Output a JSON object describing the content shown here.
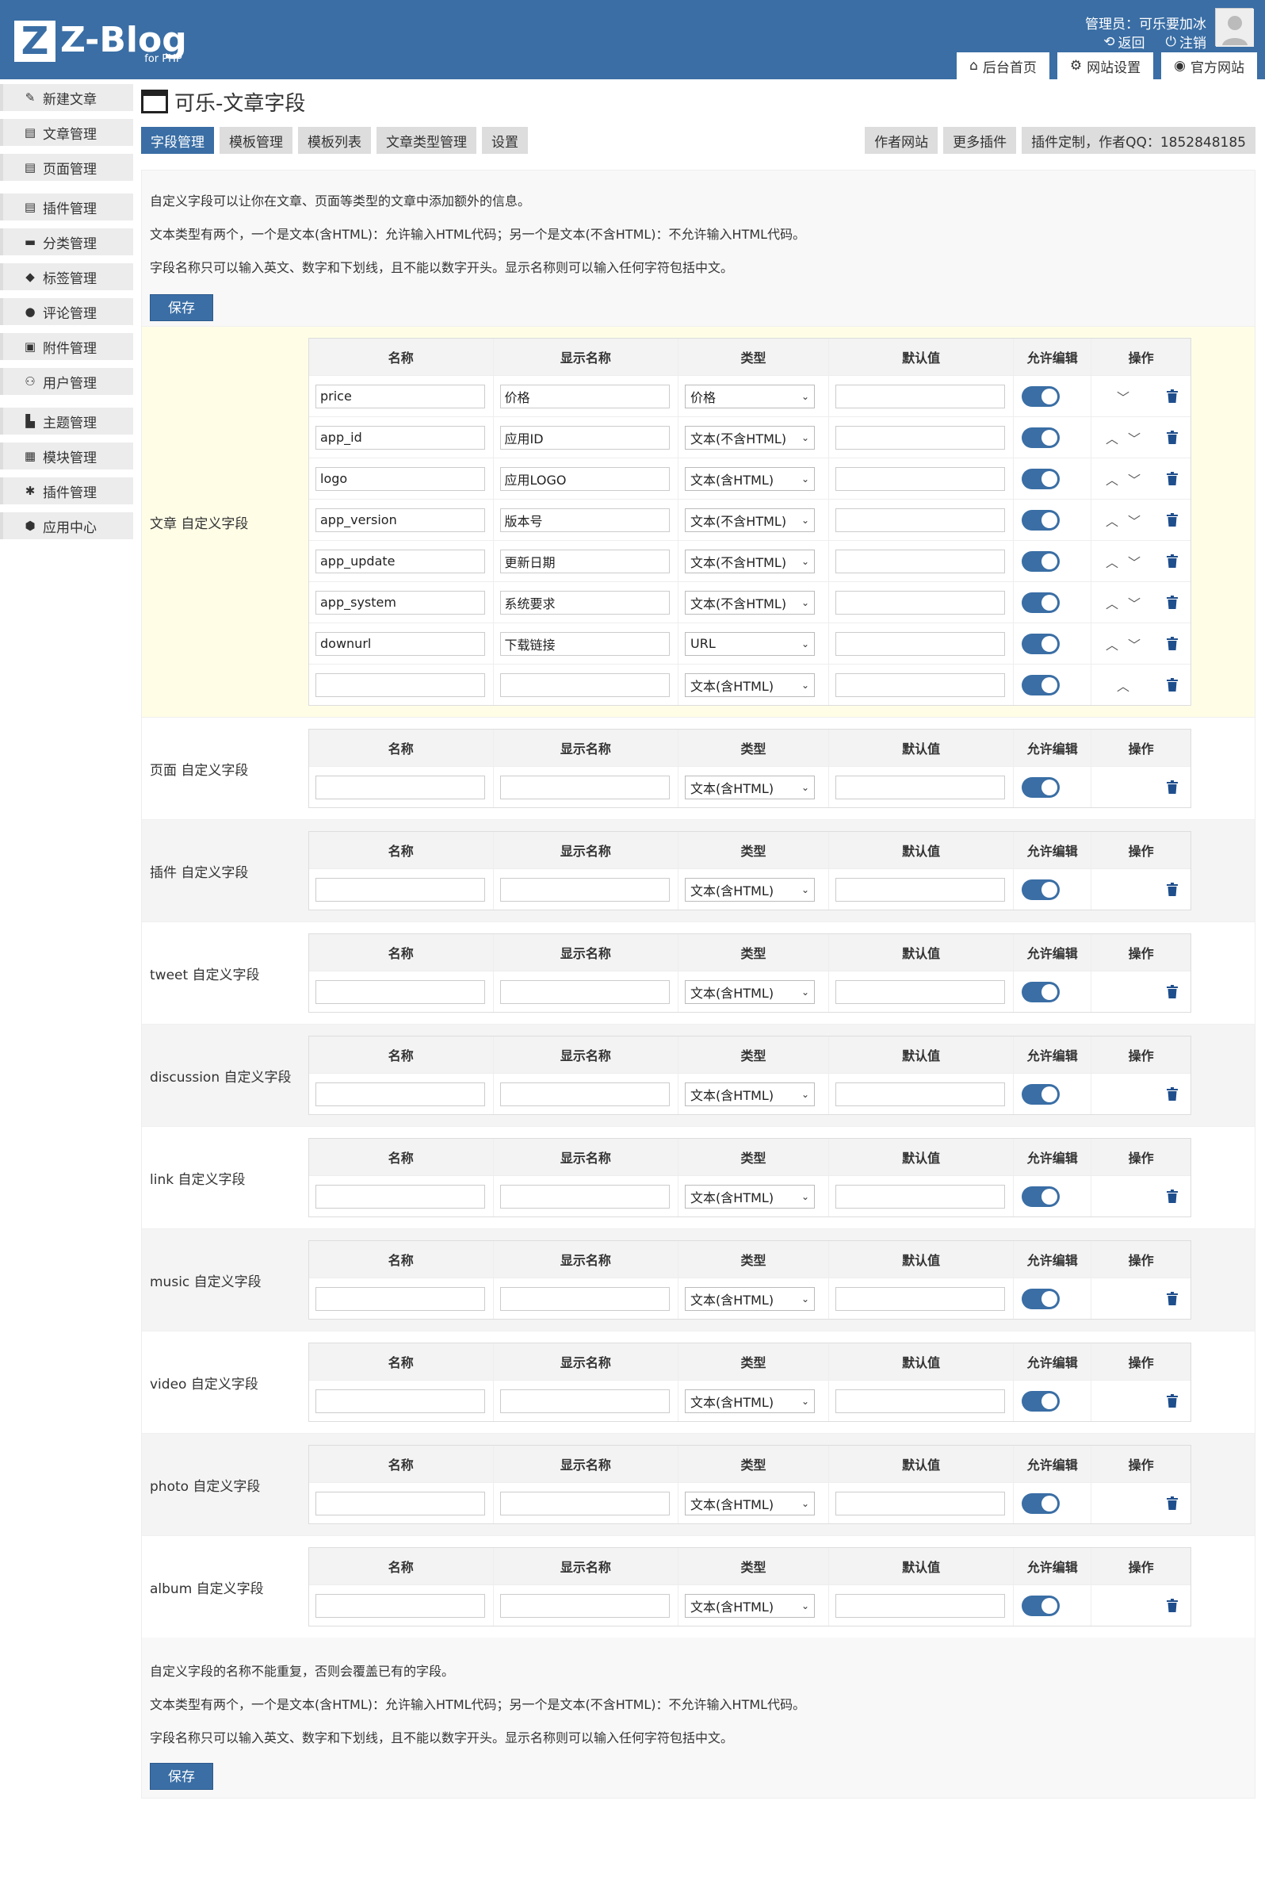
{
  "header": {
    "logo": "Z-Blog",
    "logo_sub": "for PHP",
    "admin": "管理员：可乐要加冰",
    "back": "返回",
    "logout": "注销",
    "tabs": [
      {
        "label": "后台首页",
        "icon": "home-icon"
      },
      {
        "label": "网站设置",
        "icon": "gear-icon"
      },
      {
        "label": "官方网站",
        "icon": "zblog-icon"
      }
    ]
  },
  "sidebar": {
    "items": [
      {
        "label": "新建文章",
        "icon": "pencil-icon"
      },
      {
        "label": "文章管理",
        "icon": "article-icon"
      },
      {
        "label": "页面管理",
        "icon": "page-icon"
      },
      {
        "label": "插件管理",
        "icon": "plugin-list-icon"
      },
      {
        "label": "分类管理",
        "icon": "folder-icon"
      },
      {
        "label": "标签管理",
        "icon": "tag-icon"
      },
      {
        "label": "评论管理",
        "icon": "comment-icon"
      },
      {
        "label": "附件管理",
        "icon": "attachment-icon"
      },
      {
        "label": "用户管理",
        "icon": "users-icon"
      },
      {
        "label": "主题管理",
        "icon": "theme-icon"
      },
      {
        "label": "模块管理",
        "icon": "module-icon"
      },
      {
        "label": "插件管理",
        "icon": "puzzle-icon"
      },
      {
        "label": "应用中心",
        "icon": "box-icon"
      }
    ]
  },
  "main": {
    "title": "可乐-文章字段",
    "tabs": [
      "字段管理",
      "模板管理",
      "模板列表",
      "文章类型管理",
      "设置"
    ],
    "right_tabs": [
      "作者网站",
      "更多插件",
      "插件定制，作者QQ：1852848185"
    ],
    "desc": [
      "自定义字段可以让你在文章、页面等类型的文章中添加额外的信息。",
      "文本类型有两个，一个是文本(含HTML)：允许输入HTML代码；另一个是文本(不含HTML)：不允许输入HTML代码。",
      "字段名称只可以输入英文、数字和下划线，且不能以数字开头。显示名称则可以输入任何字符包括中文。"
    ],
    "save": "保存",
    "columns": [
      "名称",
      "显示名称",
      "类型",
      "默认值",
      "允许编辑",
      "操作"
    ],
    "article_label": "文章 自定义字段",
    "article_rows": [
      {
        "name": "price",
        "display": "价格",
        "type": "价格",
        "default": "",
        "up": false,
        "down": true
      },
      {
        "name": "app_id",
        "display": "应用ID",
        "type": "文本(不含HTML)",
        "default": "",
        "up": true,
        "down": true
      },
      {
        "name": "logo",
        "display": "应用LOGO",
        "type": "文本(含HTML)",
        "default": "",
        "up": true,
        "down": true
      },
      {
        "name": "app_version",
        "display": "版本号",
        "type": "文本(不含HTML)",
        "default": "",
        "up": true,
        "down": true
      },
      {
        "name": "app_update",
        "display": "更新日期",
        "type": "文本(不含HTML)",
        "default": "",
        "up": true,
        "down": true
      },
      {
        "name": "app_system",
        "display": "系统要求",
        "type": "文本(不含HTML)",
        "default": "",
        "up": true,
        "down": true
      },
      {
        "name": "downurl",
        "display": "下载链接",
        "type": "URL",
        "default": "",
        "up": true,
        "down": true
      },
      {
        "name": "",
        "display": "",
        "type": "文本(含HTML)",
        "default": "",
        "up": true,
        "down": false
      }
    ],
    "other_sections": [
      "页面 自定义字段",
      "插件 自定义字段",
      "tweet 自定义字段",
      "discussion 自定义字段",
      "link 自定义字段",
      "music 自定义字段",
      "video 自定义字段",
      "photo 自定义字段",
      "album 自定义字段"
    ],
    "default_type": "文本(含HTML)",
    "footer_desc": [
      "自定义字段的名称不能重复，否则会覆盖已有的字段。",
      "文本类型有两个，一个是文本(含HTML)：允许输入HTML代码；另一个是文本(不含HTML)：不允许输入HTML代码。",
      "字段名称只可以输入英文、数字和下划线，且不能以数字开头。显示名称则可以输入任何字符包括中文。"
    ]
  }
}
